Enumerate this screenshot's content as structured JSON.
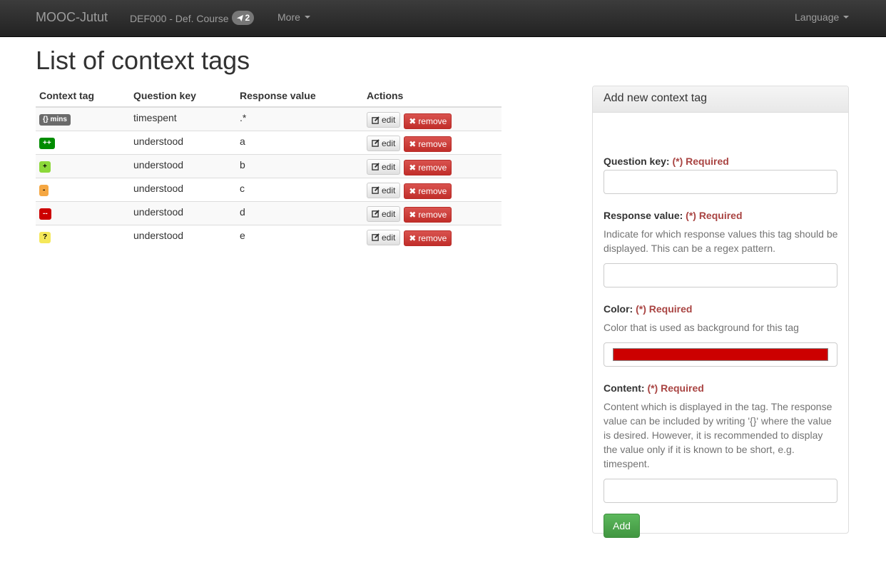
{
  "navbar": {
    "brand": "MOOC-Jutut",
    "course": "DEF000 - Def. Course",
    "badge_count": "2",
    "more": "More",
    "language": "Language"
  },
  "page": {
    "title": "List of context tags"
  },
  "table": {
    "headers": [
      "Context tag",
      "Question key",
      "Response value",
      "Actions"
    ],
    "rows": [
      {
        "tag": "{} mins",
        "color": "#6b6b6b",
        "text_color": "#ffffff",
        "question_key": "timespent",
        "response_value": ".*"
      },
      {
        "tag": "++",
        "color": "#008c00",
        "text_color": "#ffffff",
        "question_key": "understood",
        "response_value": "a"
      },
      {
        "tag": "+",
        "color": "#8cd83a",
        "text_color": "#000000",
        "question_key": "understood",
        "response_value": "b"
      },
      {
        "tag": "-",
        "color": "#f5a742",
        "text_color": "#000000",
        "question_key": "understood",
        "response_value": "c"
      },
      {
        "tag": "--",
        "color": "#cc0000",
        "text_color": "#ffffff",
        "question_key": "understood",
        "response_value": "d"
      },
      {
        "tag": "?",
        "color": "#f5e85a",
        "text_color": "#000000",
        "question_key": "understood",
        "response_value": "e"
      }
    ],
    "edit_label": "edit",
    "remove_label": "remove"
  },
  "form": {
    "heading": "Add new context tag",
    "required": "(*) Required",
    "question_key_label": "Question key:",
    "response_value_label": "Response value:",
    "response_value_help": "Indicate for which response values this tag should be displayed. This can be a regex pattern.",
    "color_label": "Color:",
    "color_help": "Color that is used as background for this tag",
    "color_value": "#cc0000",
    "content_label": "Content:",
    "content_help": "Content which is displayed in the tag. The response value can be included by writing '{}' where the value is desired. However, it is recommended to display the value only if it is known to be short, e.g. timespent.",
    "add_label": "Add"
  }
}
